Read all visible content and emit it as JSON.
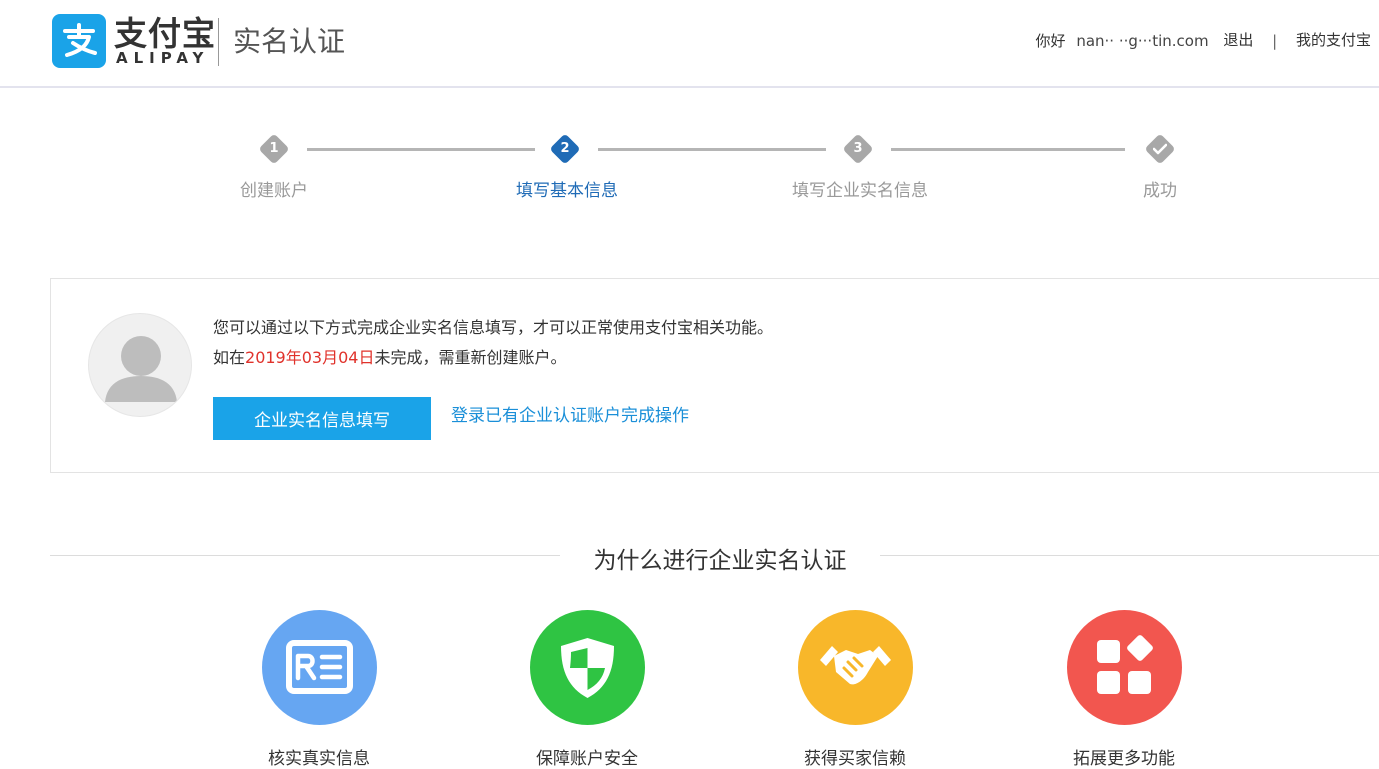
{
  "header": {
    "brand_cn": "支付宝",
    "brand_en": "ALIPAY",
    "page_title": "实名认证",
    "greeting": "你好",
    "email": "nan·· ··g···tin.com",
    "logout": "退出",
    "separator": "|",
    "my_alipay": "我的支付宝"
  },
  "steps": [
    {
      "num": "1",
      "label": "创建账户",
      "state": "inactive"
    },
    {
      "num": "2",
      "label": "填写基本信息",
      "state": "active"
    },
    {
      "num": "3",
      "label": "填写企业实名信息",
      "state": "inactive"
    },
    {
      "num": "",
      "label": "成功",
      "state": "inactive",
      "icon": "check-icon"
    }
  ],
  "info": {
    "line1": "您可以通过以下方式完成企业实名信息填写，才可以正常使用支付宝相关功能。",
    "line2_prefix": "如在",
    "line2_date": "2019年03月04日",
    "line2_suffix": "未完成，需重新创建账户。",
    "primary_button": "企业实名信息填写",
    "link": "登录已有企业认证账户完成操作"
  },
  "why": {
    "title": "为什么进行企业实名认证",
    "features": [
      {
        "label": "核实真实信息",
        "icon": "id-card-icon",
        "color": "#66a6f2"
      },
      {
        "label": "保障账户安全",
        "icon": "shield-icon",
        "color": "#2fc443"
      },
      {
        "label": "获得买家信赖",
        "icon": "handshake-icon",
        "color": "#f8b72a"
      },
      {
        "label": "拓展更多功能",
        "icon": "apps-icon",
        "color": "#f2564f"
      }
    ]
  },
  "colors": {
    "brand_blue": "#1aa3e8",
    "step_active": "#1f6bb6",
    "step_inactive": "#a8a8a8",
    "deadline_red": "#e0322b",
    "link_blue": "#1a8fd8"
  }
}
